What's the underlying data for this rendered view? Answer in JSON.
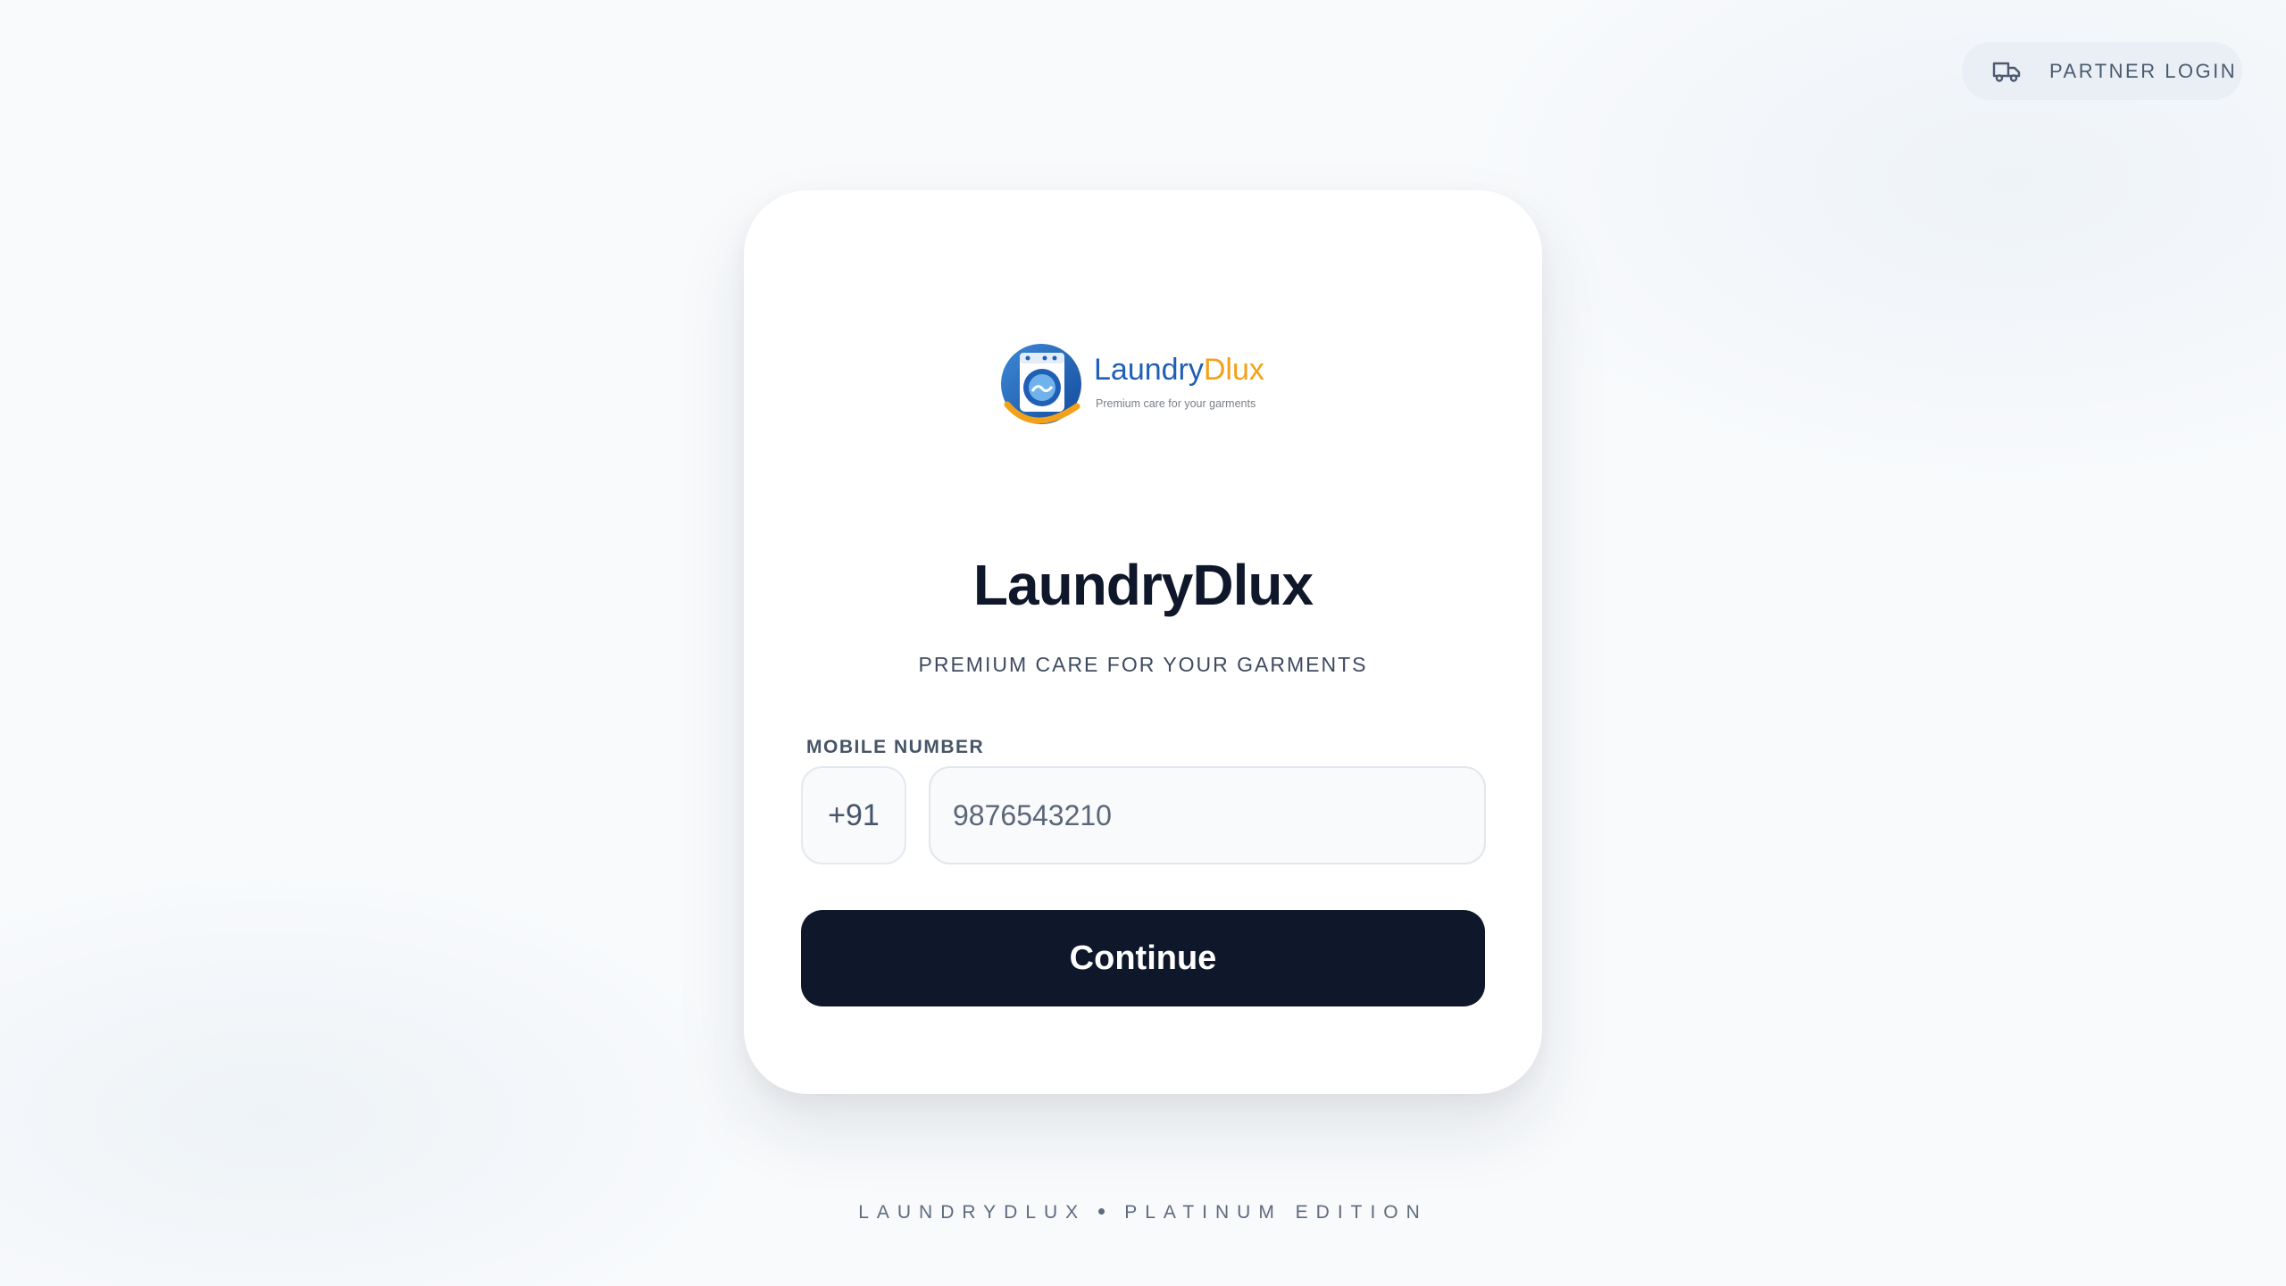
{
  "header": {
    "partner_login_label": "PARTNER LOGIN",
    "partner_icon": "truck-icon"
  },
  "logo": {
    "brand_part1": "Laundry",
    "brand_part2": "Dlux",
    "tagline": "Premium care for your garments",
    "icon": "washing-machine-icon"
  },
  "card": {
    "title": "LaundryDlux",
    "subtitle": "PREMIUM CARE FOR YOUR GARMENTS",
    "mobile_label": "MOBILE NUMBER",
    "country_code": "+91",
    "mobile_placeholder": "9876543210",
    "continue_label": "Continue"
  },
  "footer": {
    "left": "LAUNDRYDLUX",
    "right": "PLATINUM EDITION"
  },
  "colors": {
    "primary_dark": "#0f172a",
    "brand_blue": "#1f5fb5",
    "brand_orange": "#f2a21a",
    "background": "#f8fafc"
  }
}
